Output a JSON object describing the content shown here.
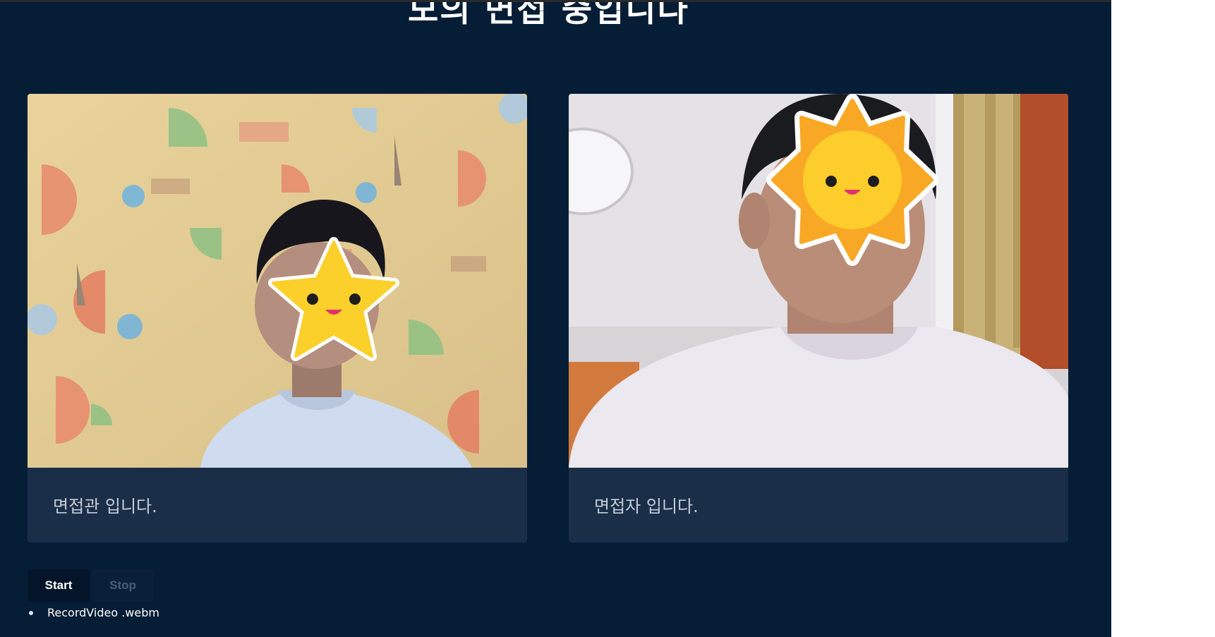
{
  "page": {
    "title": "모의 면접 중입니다"
  },
  "interviewer": {
    "caption": "면접관 입니다.",
    "face_sticker": "star-face-sticker"
  },
  "interviewee": {
    "caption": "면접자 입니다.",
    "face_sticker": "sun-face-sticker"
  },
  "controls": {
    "start_label": "Start",
    "stop_label": "Stop"
  },
  "recordings": [
    "RecordVideo .webm"
  ],
  "colors": {
    "background": "#061d36",
    "card": "#1b2e48",
    "sticker_yellow": "#fbd02b"
  }
}
